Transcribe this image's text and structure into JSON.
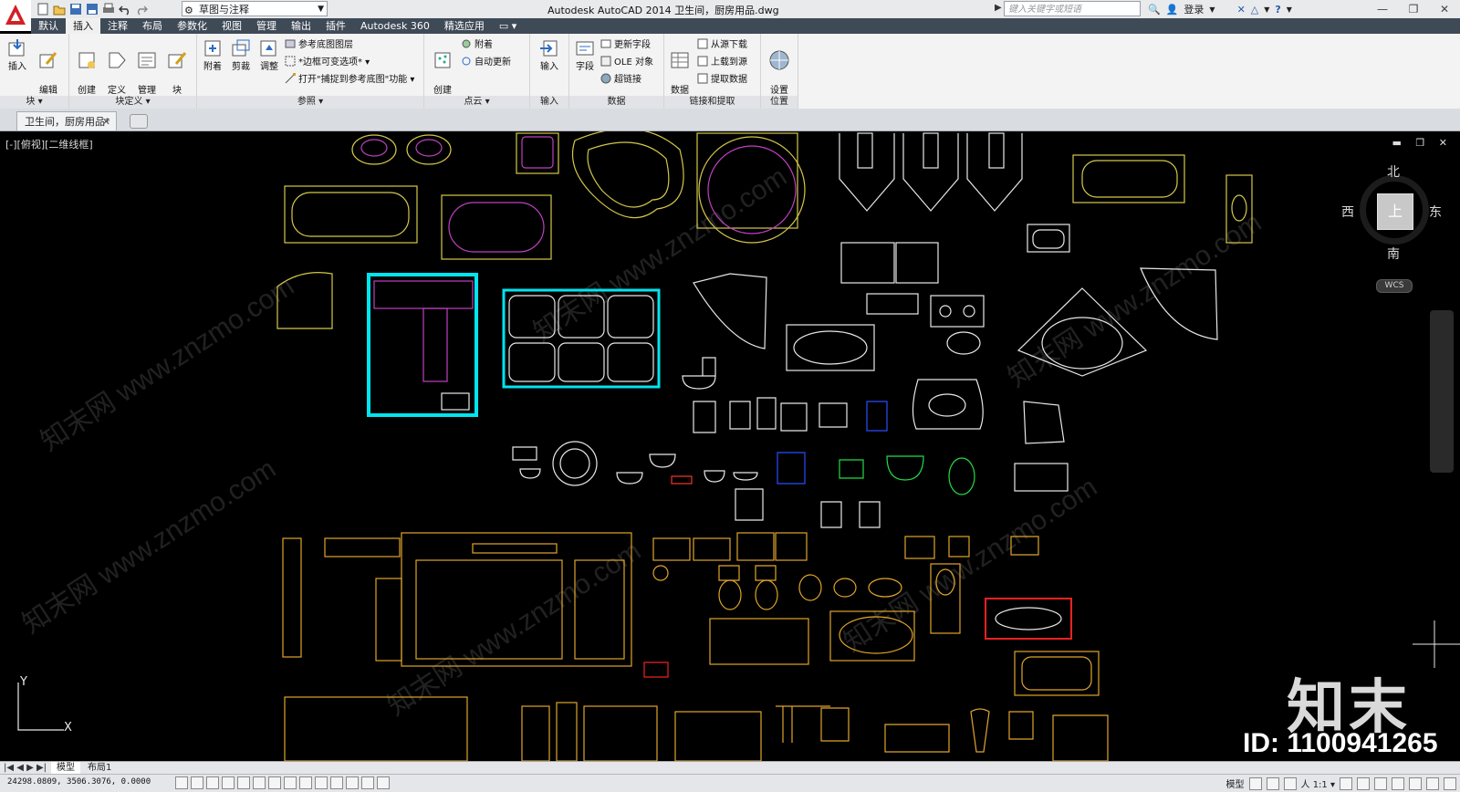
{
  "app": {
    "title": "Autodesk AutoCAD 2014    卫生间，厨房用品.dwg",
    "workspace": "草图与注释",
    "search_placeholder": "键入关键字或短语",
    "login": "登录",
    "window_controls": [
      "—",
      "❐",
      "✕"
    ]
  },
  "menu_tabs": [
    "默认",
    "插入",
    "注释",
    "布局",
    "参数化",
    "视图",
    "管理",
    "输出",
    "插件",
    "Autodesk 360",
    "精选应用",
    "▭ ▾"
  ],
  "active_tab_index": 1,
  "ribbon": {
    "panels": [
      {
        "title": "块 ▾",
        "buttons": [
          "插入",
          "编辑\n属性"
        ]
      },
      {
        "title": "块定义 ▾",
        "buttons": [
          "创建\n块",
          "定义\n属性",
          "管理\n属性",
          "块\n编辑器"
        ]
      },
      {
        "title": "参照 ▾",
        "buttons": [
          "附着",
          "剪裁",
          "调整"
        ],
        "small": [
          "参考底图图层",
          "*边框可变选项*",
          "打开\"捕捉到参考底图\"功能"
        ]
      },
      {
        "title": "点云 ▾",
        "buttons": [
          "创建\n点云"
        ],
        "small": [
          "附着",
          "自动更新"
        ]
      },
      {
        "title": "输入",
        "buttons": [
          "输入"
        ]
      },
      {
        "title": "数据",
        "buttons": [
          "字段"
        ],
        "small": [
          "更新字段",
          "OLE 对象",
          "超链接"
        ]
      },
      {
        "title": "链接和提取",
        "buttons": [
          "数据\n链接"
        ],
        "small": [
          "从源下载",
          "上载到源",
          "提取数据"
        ]
      },
      {
        "title": "位置",
        "buttons": [
          "设置\n位置"
        ]
      }
    ]
  },
  "document_tab": "卫生间，厨房用品*",
  "viewport": {
    "label": "[-][俯视][二维线框]",
    "viewcube": {
      "north": "北",
      "south": "南",
      "west": "西",
      "east": "东",
      "face": "上",
      "wcs": "WCS"
    }
  },
  "ucs": {
    "y": "Y",
    "x": "X"
  },
  "layout_tabs": [
    "模型",
    "布局1"
  ],
  "status": {
    "coordinates": "24298.0809, 3506.3076, 0.0000",
    "model": "模型",
    "scale": "人 1:1 ▾"
  },
  "watermark": {
    "logo": "知末",
    "id": "ID: 1100941265",
    "site": "知末网 www.znzmo.com"
  },
  "colors": {
    "accent": "#d31f26",
    "titlebar": "#e9eaec",
    "tabbar": "#3f4a57",
    "canvas": "#000000"
  }
}
